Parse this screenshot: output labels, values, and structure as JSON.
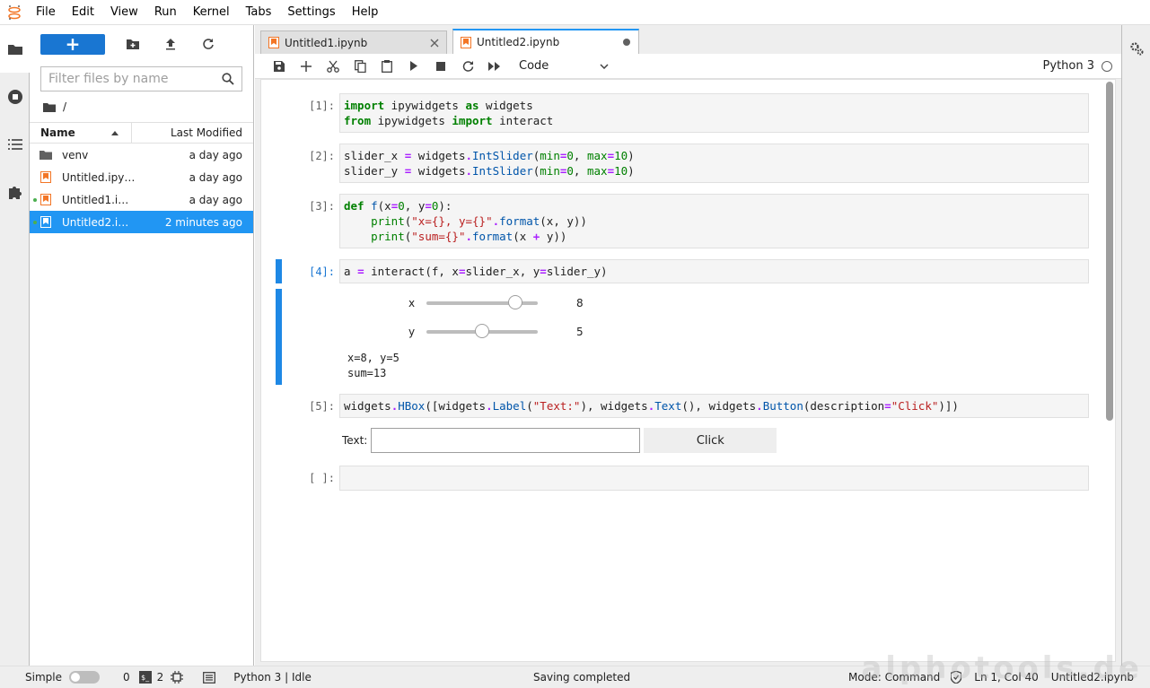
{
  "menu": [
    "File",
    "Edit",
    "View",
    "Run",
    "Kernel",
    "Tabs",
    "Settings",
    "Help"
  ],
  "filebrowser": {
    "new_label": "+",
    "filter_placeholder": "Filter files by name",
    "crumb": "/",
    "col_name": "Name",
    "col_modified": "Last Modified",
    "files": [
      {
        "name": "venv",
        "modified": "a day ago",
        "type": "folder",
        "running": false,
        "selected": false
      },
      {
        "name": "Untitled.ipy…",
        "modified": "a day ago",
        "type": "notebook",
        "running": false,
        "selected": false
      },
      {
        "name": "Untitled1.i…",
        "modified": "a day ago",
        "type": "notebook",
        "running": true,
        "selected": false
      },
      {
        "name": "Untitled2.i…",
        "modified": "2 minutes ago",
        "type": "notebook",
        "running": true,
        "selected": true
      }
    ]
  },
  "tabs": [
    {
      "label": "Untitled1.ipynb",
      "active": false
    },
    {
      "label": "Untitled2.ipynb",
      "active": true
    }
  ],
  "toolbar": {
    "cell_type": "Code",
    "kernel": "Python 3"
  },
  "cells": {
    "c1": {
      "prompt": "[1]:"
    },
    "c2": {
      "prompt": "[2]:"
    },
    "c3": {
      "prompt": "[3]:"
    },
    "c4": {
      "prompt": "[4]:"
    },
    "c5": {
      "prompt": "[5]:"
    },
    "c6": {
      "prompt": "[ ]:"
    }
  },
  "widgets": {
    "slider_x": {
      "label": "x",
      "value": "8",
      "min": 0,
      "max": 10
    },
    "slider_y": {
      "label": "y",
      "value": "5",
      "min": 0,
      "max": 10
    },
    "stdout": [
      "x=8, y=5",
      "sum=13"
    ],
    "text_label": "Text:",
    "button_label": "Click"
  },
  "statusbar": {
    "simple": "Simple",
    "count1": "0",
    "count2": "2",
    "kernel_status": "Python 3 | Idle",
    "saving": "Saving completed",
    "mode": "Mode: Command",
    "position": "Ln 1, Col 40",
    "filename": "Untitled2.ipynb"
  },
  "watermark": "alphotools.de",
  "colors": {
    "accent": "#2196f3",
    "brand": "#f37626",
    "running": "#4caf50"
  }
}
